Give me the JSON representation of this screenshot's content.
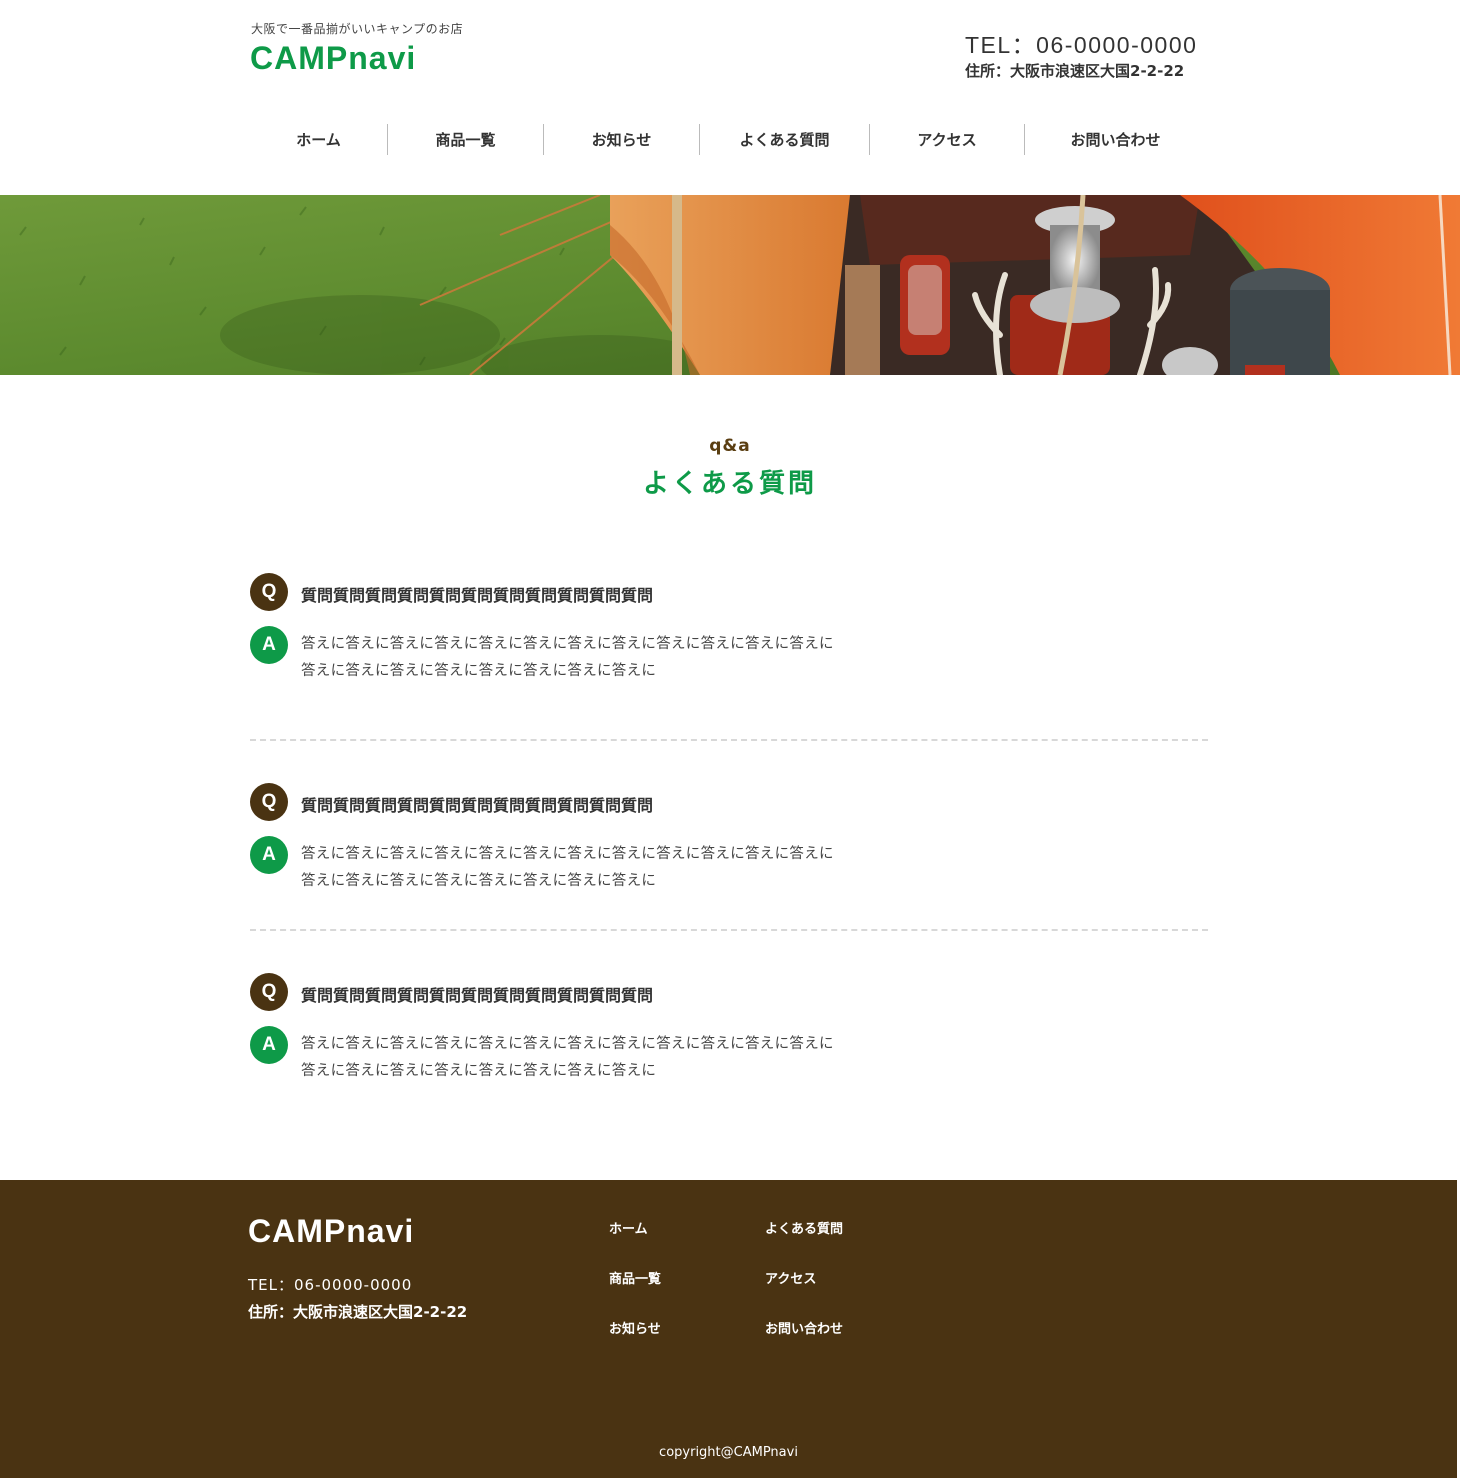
{
  "header": {
    "tagline": "大阪で一番品揃がいいキャンプのお店",
    "logo": "CAMPnavi",
    "tel": "TEL：06-0000-0000",
    "address": "住所：大阪市浪速区大国2-2-22"
  },
  "nav": {
    "items": [
      {
        "label": "ホーム"
      },
      {
        "label": "商品一覧"
      },
      {
        "label": "お知らせ"
      },
      {
        "label": "よくある質問"
      },
      {
        "label": "アクセス"
      },
      {
        "label": "お問い合わせ"
      }
    ]
  },
  "section": {
    "subtitle": "q&a",
    "title": "よくある質問"
  },
  "qa": [
    {
      "q_badge": "Q",
      "question": "質問質問質問質問質問質問質問質問質問質問質問",
      "a_badge": "A",
      "answer": "答えに答えに答えに答えに答えに答えに答えに答えに答えに答えに答えに答えに答えに答えに答えに答えに答えに答えに答えに答えに"
    },
    {
      "q_badge": "Q",
      "question": "質問質問質問質問質問質問質問質問質問質問質問",
      "a_badge": "A",
      "answer": "答えに答えに答えに答えに答えに答えに答えに答えに答えに答えに答えに答えに答えに答えに答えに答えに答えに答えに答えに答えに"
    },
    {
      "q_badge": "Q",
      "question": "質問質問質問質問質問質問質問質問質問質問質問",
      "a_badge": "A",
      "answer": "答えに答えに答えに答えに答えに答えに答えに答えに答えに答えに答えに答えに答えに答えに答えに答えに答えに答えに答えに答えに"
    }
  ],
  "footer": {
    "logo": "CAMPnavi",
    "tel": "TEL：06-0000-0000",
    "address": "住所：大阪市浪速区大国2-2-22",
    "links": [
      {
        "label": "ホーム"
      },
      {
        "label": "商品一覧"
      },
      {
        "label": "お知らせ"
      },
      {
        "label": "よくある質問"
      },
      {
        "label": "アクセス"
      },
      {
        "label": "お問い合わせ"
      }
    ],
    "copyright": "copyright@CAMPnavi"
  },
  "colors": {
    "brand_green": "#0e9a48",
    "brand_brown": "#4a3312"
  }
}
